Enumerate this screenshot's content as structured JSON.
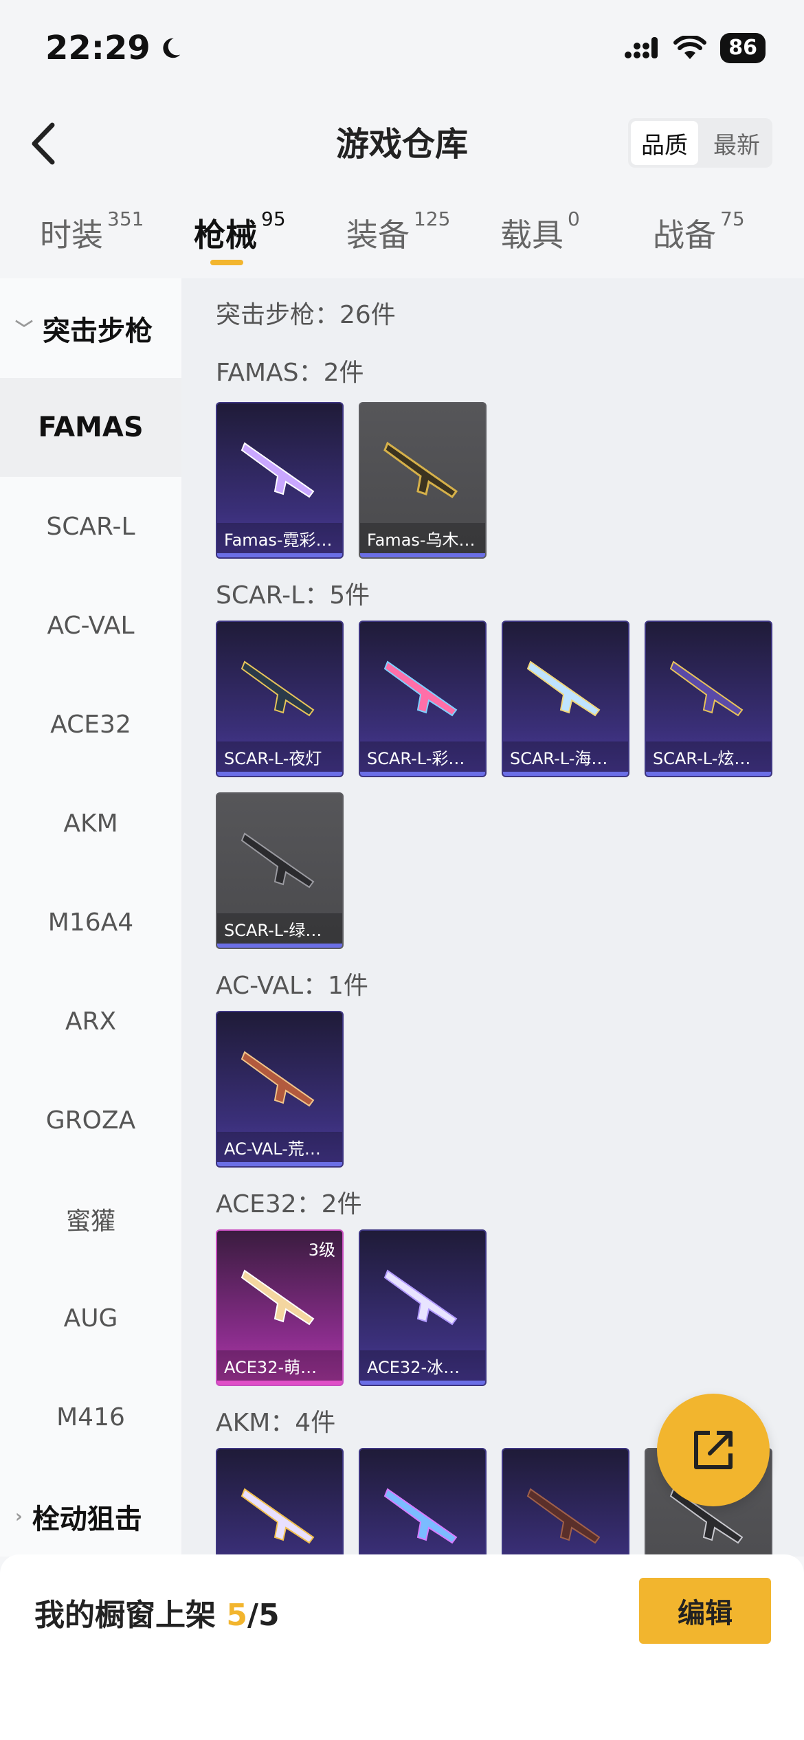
{
  "status_bar": {
    "time": "22:29",
    "battery": "86"
  },
  "header": {
    "title": "游戏仓库",
    "sort_options": [
      "品质",
      "最新"
    ],
    "active_sort": "品质"
  },
  "tabs": [
    {
      "label": "时装",
      "count": "351"
    },
    {
      "label": "枪械",
      "count": "95"
    },
    {
      "label": "装备",
      "count": "125"
    },
    {
      "label": "载具",
      "count": "0"
    },
    {
      "label": "战备",
      "count": "75"
    }
  ],
  "active_tab": "枪械",
  "side_nav": {
    "group_open": "突击步枪",
    "items": [
      "FAMAS",
      "SCAR-L",
      "AC-VAL",
      "ACE32",
      "AKM",
      "M16A4",
      "ARX",
      "GROZA",
      "蜜獾",
      "AUG",
      "M416"
    ],
    "active_item": "FAMAS",
    "group_closed": "栓动狙击"
  },
  "content": {
    "section_total": "突击步枪：26件",
    "groups": [
      {
        "title": "FAMAS：2件",
        "items": [
          {
            "label": "Famas-霓彩…",
            "rarity": "epic"
          },
          {
            "label": "Famas-乌木…",
            "rarity": "common"
          }
        ]
      },
      {
        "title": "SCAR-L：5件",
        "items": [
          {
            "label": "SCAR-L-夜灯",
            "rarity": "epic"
          },
          {
            "label": "SCAR-L-彩…",
            "rarity": "epic"
          },
          {
            "label": "SCAR-L-海…",
            "rarity": "epic"
          },
          {
            "label": "SCAR-L-炫…",
            "rarity": "epic"
          },
          {
            "label": "SCAR-L-绿…",
            "rarity": "common"
          }
        ]
      },
      {
        "title": "AC-VAL：1件",
        "items": [
          {
            "label": "AC-VAL-荒…",
            "rarity": "epic"
          }
        ]
      },
      {
        "title": "ACE32：2件",
        "items": [
          {
            "label": "ACE32-萌…",
            "rarity": "legendary",
            "level": "3级"
          },
          {
            "label": "ACE32-冰…",
            "rarity": "epic"
          }
        ]
      },
      {
        "title": "AKM：4件",
        "items": [
          {
            "label": "",
            "rarity": "epic"
          },
          {
            "label": "",
            "rarity": "epic"
          },
          {
            "label": "",
            "rarity": "epic"
          },
          {
            "label": "",
            "rarity": "common"
          }
        ]
      }
    ]
  },
  "bottom_bar": {
    "showcase_label": "我的橱窗上架",
    "showcase_current": "5",
    "showcase_total": "/5",
    "edit_label": "编辑"
  },
  "colors": {
    "accent": "#f2b52e",
    "epic": "#3a2f78",
    "legendary": "#b43aa8",
    "common": "#4a4a4d"
  }
}
